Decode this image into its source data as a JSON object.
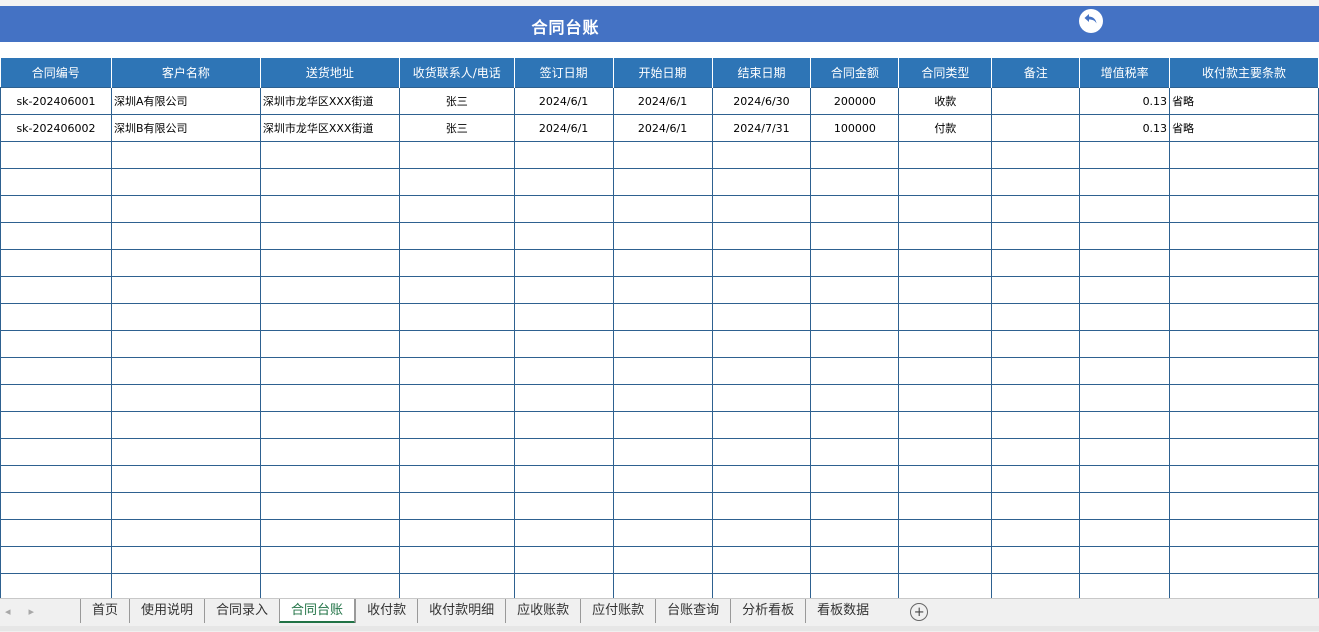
{
  "title": "合同台账",
  "back_icon": "undo-arrow-icon",
  "columns": [
    "合同编号",
    "客户名称",
    "送货地址",
    "收货联系人/电话",
    "签订日期",
    "开始日期",
    "结束日期",
    "合同金额",
    "合同类型",
    "备注",
    "增值税率",
    "收付款主要条款"
  ],
  "rows": [
    [
      "sk-202406001",
      "深圳A有限公司",
      "深圳市龙华区XXX街道",
      "张三",
      "2024/6/1",
      "2024/6/1",
      "2024/6/30",
      "200000",
      "收款",
      "",
      "0.13",
      "省略"
    ],
    [
      "sk-202406002",
      "深圳B有限公司",
      "深圳市龙华区XXX街道",
      "张三",
      "2024/6/1",
      "2024/6/1",
      "2024/7/31",
      "100000",
      "付款",
      "",
      "0.13",
      "省略"
    ]
  ],
  "tabs": [
    "首页",
    "使用说明",
    "合同录入",
    "合同台账",
    "收付款",
    "收付款明细",
    "应收账款",
    "应付账款",
    "台账查询",
    "分析看板",
    "看板数据"
  ],
  "active_tab": "合同台账",
  "colors": {
    "title_bg": "#4472c4",
    "header_bg": "#2e75b6",
    "grid_border": "#2e6190",
    "active_tab_text": "#217346"
  }
}
